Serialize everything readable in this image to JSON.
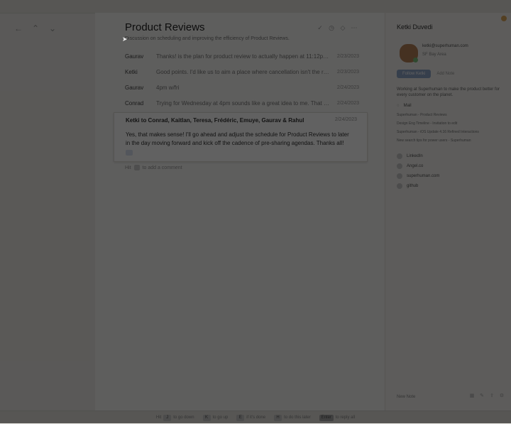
{
  "header": {
    "subject": "Product Reviews",
    "description": "Discussion on scheduling and improving the efficiency of Product Reviews."
  },
  "messages": [
    {
      "sender": "Gaurav",
      "snippet": "Thanks! is the plan for product review to actually happen at 11:12pm every we...",
      "date": "2/23/2023"
    },
    {
      "sender": "Ketki",
      "snippet": "Good points. I'd like us to aim a place where cancellation isn't the rule once...",
      "date": "2/23/2023"
    },
    {
      "sender": "Gaurav",
      "snippet": "4pm w/fri",
      "date": "2/24/2023"
    },
    {
      "sender": "Conrad",
      "snippet": "Trying for Wednesday at 4pm sounds like a great idea to me. That said, for vid...",
      "date": "2/24/2023"
    }
  ],
  "expanded": {
    "recipients": "Ketki to Conrad, Kaitlan, Teresa, Frédéric, Emuye, Gaurav & Rahul",
    "date": "2/24/2023",
    "body": "Yes, that makes sense! I'll go ahead and adjust the schedule for Product Reviews to later in the day moving forward and kick off the cadence of pre-sharing agendas. Thanks all!"
  },
  "reply_hint": {
    "prefix": "Hit",
    "suffix": "to add a comment"
  },
  "sidebar": {
    "name": "Ketki Duvedi",
    "email": "ketki@superhuman.com",
    "location": "SF Bay Area",
    "primary_action": "Follow Ketki",
    "secondary_action": "Add Note",
    "bio": "Working at Superhuman to make the product better for every customer on the planet.",
    "mail_label": "Mail",
    "mail_lines": [
      "Superhuman - Product Reviews",
      "Design Eng Timeline - Invitation to edit",
      "Superhuman - iOS Update 4.16 Refined Interactions",
      "New search tips for power users - Superhuman"
    ],
    "links": [
      {
        "label": "LinkedIn"
      },
      {
        "label": "Angel.co"
      },
      {
        "label": "superhuman.com"
      },
      {
        "label": "github"
      }
    ],
    "notes_label": "New Note"
  },
  "footer": {
    "hints": [
      {
        "key": "J",
        "label": "to go down"
      },
      {
        "key": "K",
        "label": "to go up"
      },
      {
        "key": "E",
        "label": "if it's done"
      },
      {
        "key": "H",
        "label": "to do this later"
      },
      {
        "key": "Enter",
        "label": "to reply all"
      }
    ]
  }
}
